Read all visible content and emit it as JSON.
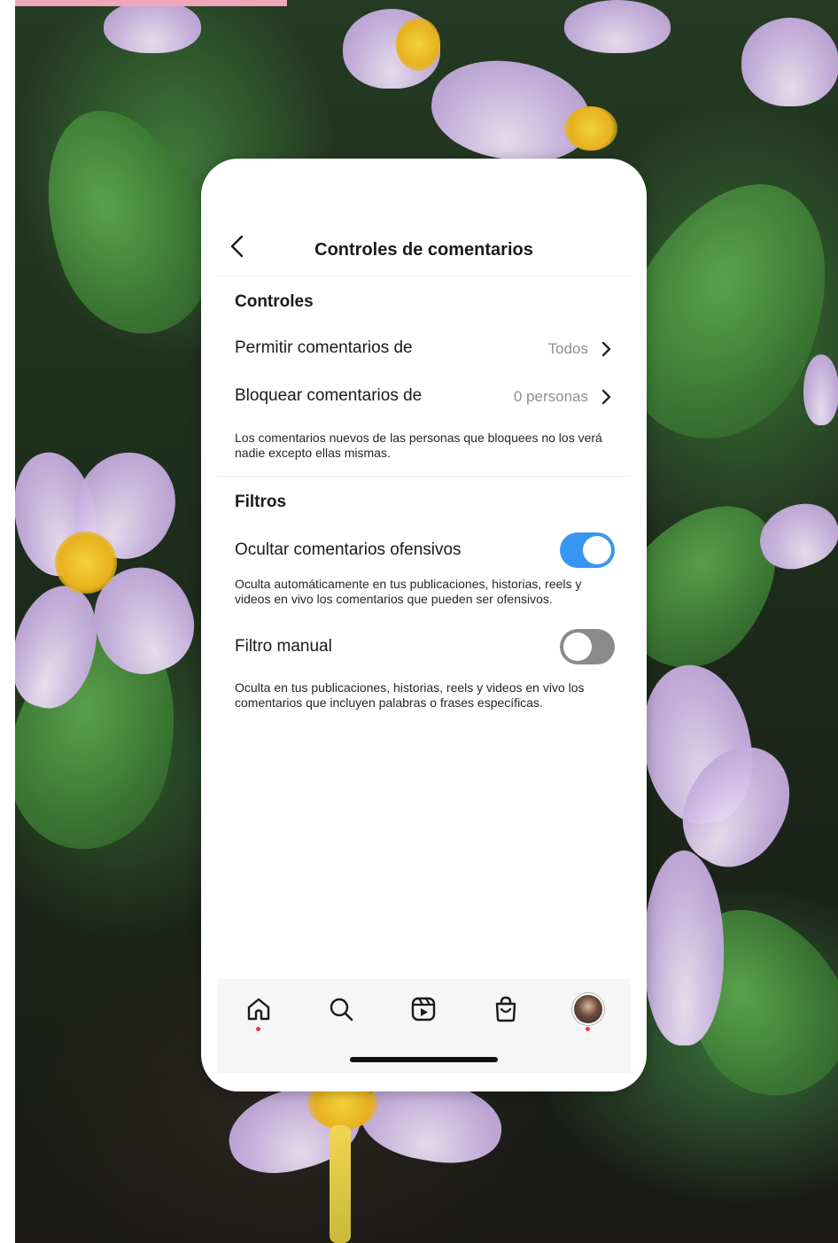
{
  "header": {
    "title": "Controles de comentarios",
    "back_icon": "chevron-left-icon"
  },
  "controls": {
    "section_title": "Controles",
    "rows": [
      {
        "label": "Permitir comentarios de",
        "value": "Todos"
      },
      {
        "label": "Bloquear comentarios de",
        "value": "0 personas"
      }
    ],
    "description": "Los comentarios nuevos de las personas que bloquees no los verá nadie excepto ellas mismas."
  },
  "filters": {
    "section_title": "Filtros",
    "offensive": {
      "label": "Ocultar comentarios ofensivos",
      "enabled": true,
      "description": "Oculta automáticamente en tus publicaciones, historias, reels y videos en vivo los comentarios que pueden ser ofensivos."
    },
    "manual": {
      "label": "Filtro manual",
      "enabled": false,
      "description": "Oculta en tus publicaciones, historias, reels y videos en vivo los comentarios que incluyen palabras o frases específicas."
    }
  },
  "tabbar": {
    "items": [
      "home-icon",
      "search-icon",
      "reels-icon",
      "shop-icon",
      "profile-avatar"
    ]
  },
  "colors": {
    "toggle_on": "#3797f0",
    "toggle_off": "#8a8a8a",
    "notification_dot": "#ff3040",
    "accent_pink": "#f1a7ba"
  }
}
